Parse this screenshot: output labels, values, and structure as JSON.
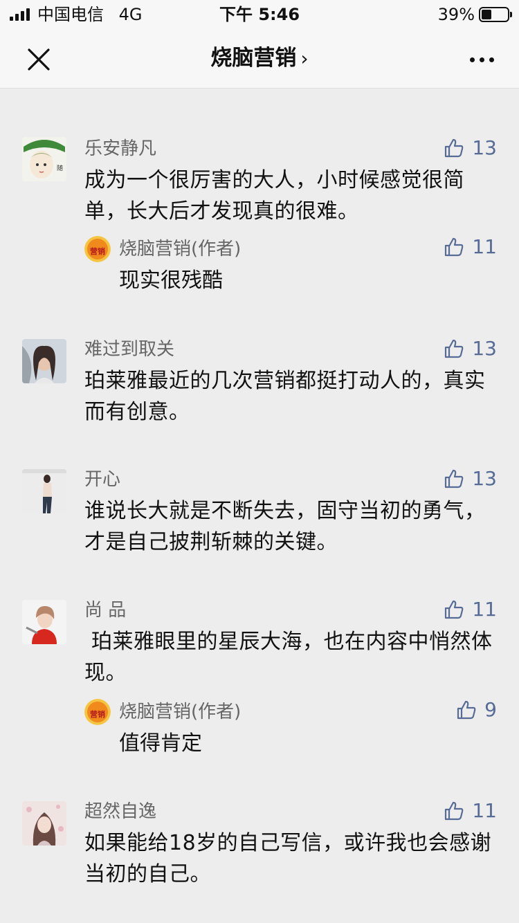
{
  "status_bar": {
    "carrier": "中国电信",
    "network": "4G",
    "time": "下午 5:46",
    "battery": "39%",
    "battery_level": 0.39
  },
  "nav": {
    "title": "烧脑营销",
    "title_chevron": "›",
    "close_icon": "close-icon",
    "more_icon": "more-icon"
  },
  "colors": {
    "like_blue": "#566b95",
    "background": "#ededed",
    "author_gray": "#666666"
  },
  "comments": [
    {
      "author": "乐安静凡",
      "likes": "13",
      "text": "成为一个很厉害的大人，小时候感觉很简单，长大后才发现真的很难。",
      "reply": {
        "author": "烧脑营销(作者)",
        "likes": "11",
        "text": "现实很残酷"
      }
    },
    {
      "author": "难过到取关",
      "likes": "13",
      "text": "珀莱雅最近的几次营销都挺打动人的，真实而有创意。"
    },
    {
      "author": "开心",
      "likes": "13",
      "text": "谁说长大就是不断失去，固守当初的勇气，才是自己披荆斩棘的关键。"
    },
    {
      "author": "尚 品",
      "likes": "11",
      "text": " 珀莱雅眼里的星辰大海，也在内容中悄然体现。",
      "reply": {
        "author": "烧脑营销(作者)",
        "likes": "9",
        "text": "值得肯定"
      }
    },
    {
      "author": "超然自逸",
      "likes": "11",
      "text": "如果能给18岁的自己写信，或许我也会感谢当初的自己。"
    }
  ],
  "author_logo_text": "营销"
}
